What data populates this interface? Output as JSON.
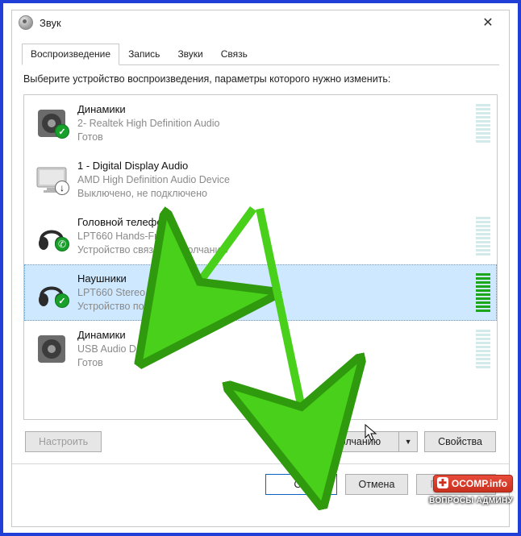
{
  "window": {
    "title": "Звук",
    "close": "✕"
  },
  "tabs": [
    {
      "label": "Воспроизведение",
      "active": true
    },
    {
      "label": "Запись",
      "active": false
    },
    {
      "label": "Звуки",
      "active": false
    },
    {
      "label": "Связь",
      "active": false
    }
  ],
  "instruction": "Выберите устройство воспроизведения, параметры которого нужно изменить:",
  "devices": [
    {
      "name": "Динамики",
      "sub": "2- Realtek High Definition Audio",
      "status": "Готов",
      "icon": "speaker",
      "badge": "green",
      "meter": "idle",
      "selected": false
    },
    {
      "name": "1 - Digital Display Audio",
      "sub": "AMD High Definition Audio Device",
      "status": "Выключено, не подключено",
      "icon": "monitor",
      "badge": "down",
      "meter": "none",
      "selected": false
    },
    {
      "name": "Головной телефон",
      "sub": "LPT660 Hands-Free",
      "status": "Устройство связи по умолчанию",
      "icon": "headphones",
      "badge": "phone",
      "meter": "idle",
      "selected": false
    },
    {
      "name": "Наушники",
      "sub": "LPT660 Stereo",
      "status": "Устройство по умолчанию",
      "icon": "headphones",
      "badge": "green",
      "meter": "active",
      "selected": true
    },
    {
      "name": "Динамики",
      "sub": "USB Audio Device",
      "status": "Готов",
      "icon": "speaker",
      "badge": "",
      "meter": "idle",
      "selected": false
    }
  ],
  "buttons": {
    "configure": "Настроить",
    "set_default": "По умолчанию",
    "properties": "Свойства",
    "ok": "OK",
    "cancel": "Отмена",
    "apply": "Применить"
  },
  "watermark": {
    "line1": "OCOMP.info",
    "line2": "ВОПРОСЫ АДМИНУ"
  }
}
